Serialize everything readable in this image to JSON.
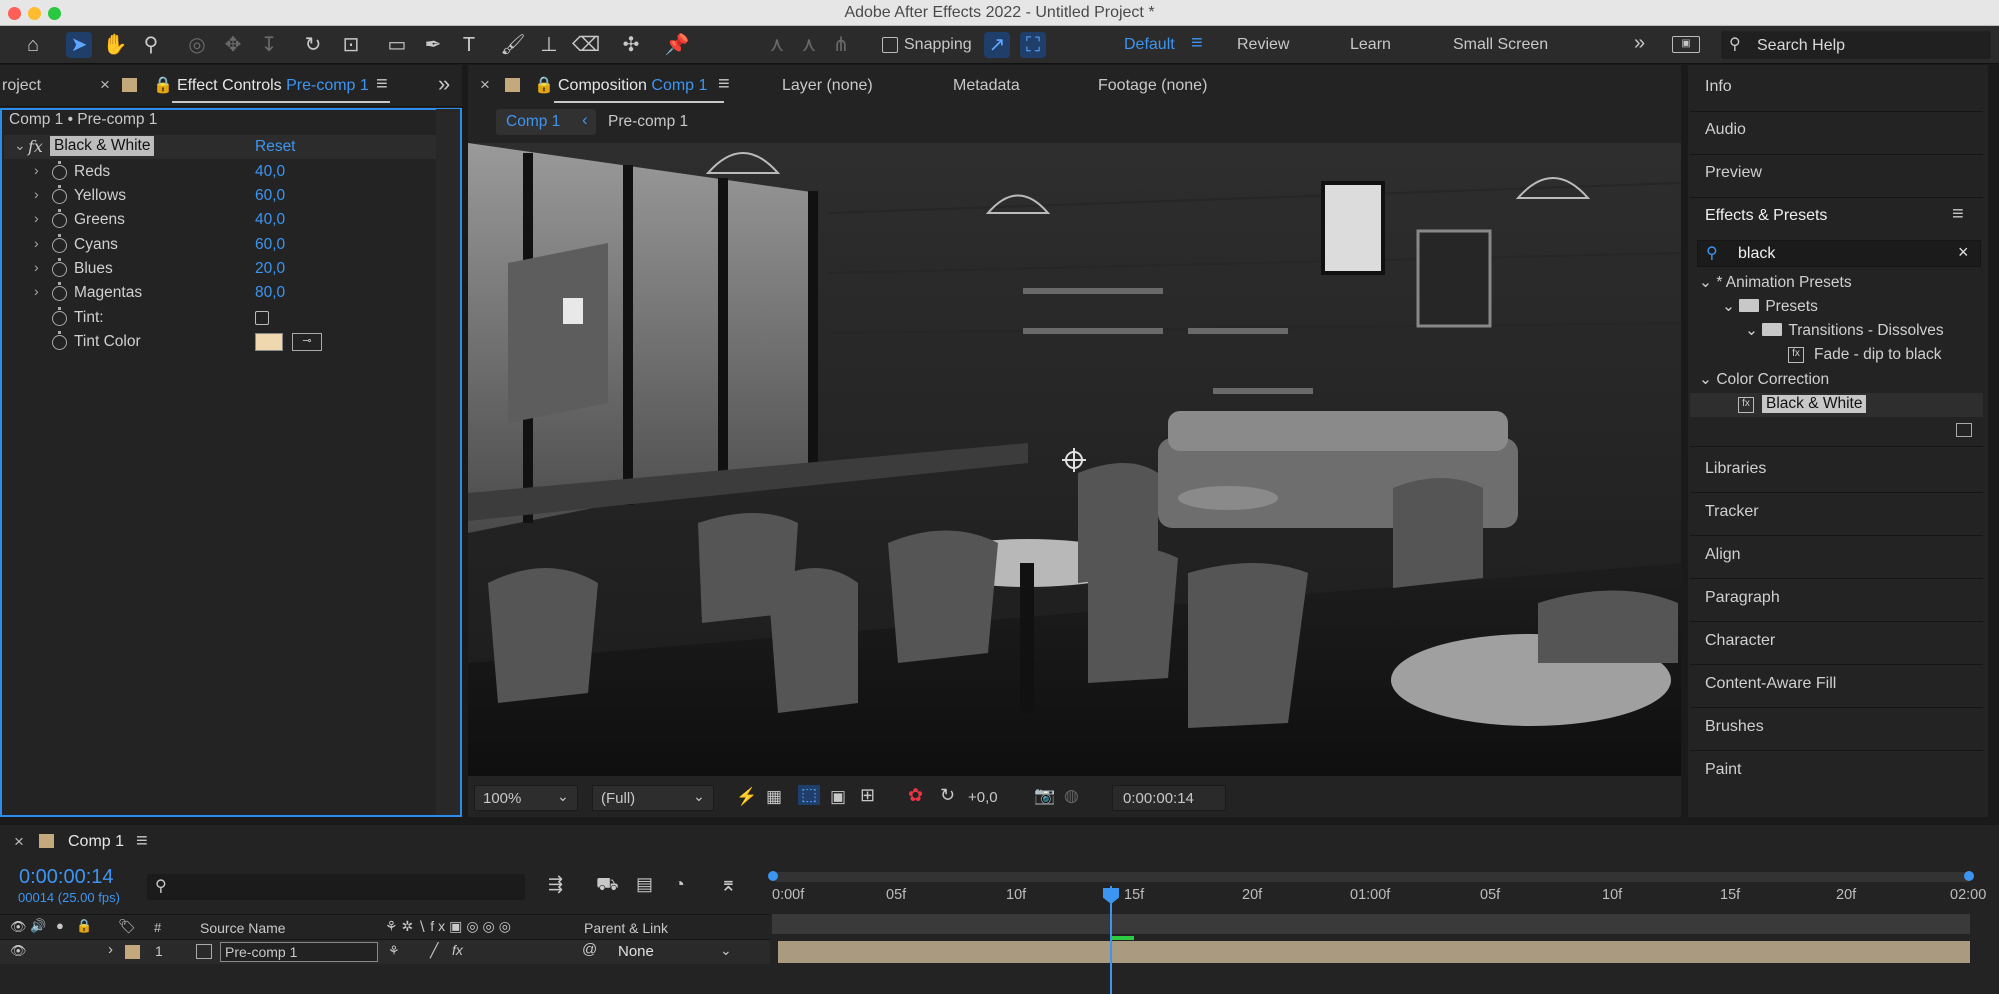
{
  "app": {
    "title": "Adobe After Effects 2022 - Untitled Project *"
  },
  "toolbar": {
    "snapping_label": "Snapping",
    "workspaces": [
      "Default",
      "Review",
      "Learn",
      "Small Screen"
    ],
    "active_workspace": "Default",
    "search_placeholder": "Search Help"
  },
  "left_panel": {
    "project_tab": "roject",
    "effect_controls_tab": "Effect Controls",
    "effect_controls_layer": "Pre-comp 1",
    "breadcrumb": "Comp 1 • Pre-comp 1",
    "effect_name": "Black & White",
    "reset_label": "Reset",
    "properties": [
      {
        "label": "Reds",
        "value": "40,0"
      },
      {
        "label": "Yellows",
        "value": "60,0"
      },
      {
        "label": "Greens",
        "value": "40,0"
      },
      {
        "label": "Cyans",
        "value": "60,0"
      },
      {
        "label": "Blues",
        "value": "20,0"
      },
      {
        "label": "Magentas",
        "value": "80,0"
      }
    ],
    "tint_label": "Tint:",
    "tint_color_label": "Tint Color",
    "tint_color": "#efd8b0"
  },
  "composition": {
    "tab_label": "Composition",
    "tab_comp": "Comp 1",
    "layer_tab": "Layer (none)",
    "metadata_tab": "Metadata",
    "footage_tab": "Footage (none)",
    "flow_current": "Comp 1",
    "flow_child": "Pre-comp 1",
    "zoom": "100%",
    "resolution": "(Full)",
    "exposure": "+0,0",
    "timecode": "0:00:00:14"
  },
  "right_panel": {
    "top_items": [
      "Info",
      "Audio",
      "Preview"
    ],
    "effects_presets_title": "Effects & Presets",
    "search_value": "black",
    "tree": {
      "animation_presets": "* Animation Presets",
      "presets": "Presets",
      "transitions": "Transitions - Dissolves",
      "fade": "Fade - dip to black",
      "color_correction": "Color Correction",
      "black_white": "Black & White"
    },
    "bottom_items": [
      "Libraries",
      "Tracker",
      "Align",
      "Paragraph",
      "Character",
      "Content-Aware Fill",
      "Brushes",
      "Paint"
    ]
  },
  "timeline": {
    "comp_tab": "Comp 1",
    "current_time": "0:00:00:14",
    "frame_info": "00014 (25.00 fps)",
    "columns": {
      "num": "#",
      "source_name": "Source Name",
      "parent_link": "Parent & Link"
    },
    "layer": {
      "index": "1",
      "name": "Pre-comp 1",
      "parent": "None"
    },
    "ruler": [
      "0:00f",
      "05f",
      "10f",
      "15f",
      "20f",
      "01:00f",
      "05f",
      "10f",
      "15f",
      "20f",
      "02:00"
    ]
  },
  "colors": {
    "accent": "#3d95f2",
    "layer_bar": "#a99a80",
    "label_swatch": "#c3a97c"
  }
}
